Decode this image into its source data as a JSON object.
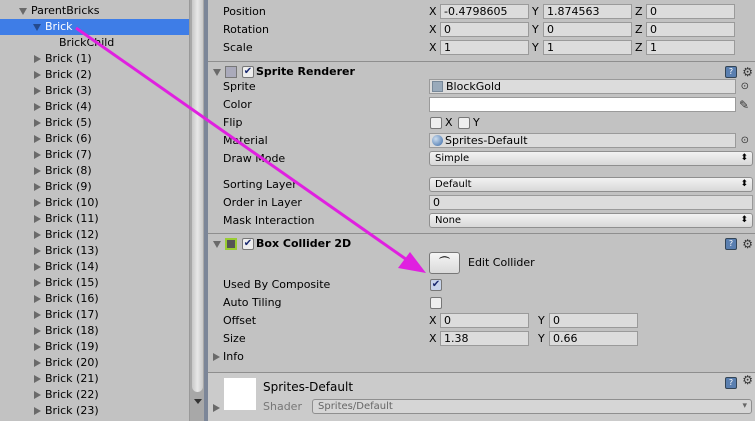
{
  "hierarchy": {
    "root": "ParentBricks",
    "selected": "Brick",
    "child": "BrickChild",
    "items": [
      "Brick (1)",
      "Brick (2)",
      "Brick (3)",
      "Brick (4)",
      "Brick (5)",
      "Brick (6)",
      "Brick (7)",
      "Brick (8)",
      "Brick (9)",
      "Brick (10)",
      "Brick (11)",
      "Brick (12)",
      "Brick (13)",
      "Brick (14)",
      "Brick (15)",
      "Brick (16)",
      "Brick (17)",
      "Brick (18)",
      "Brick (19)",
      "Brick (20)",
      "Brick (21)",
      "Brick (22)",
      "Brick (23)"
    ]
  },
  "transform": {
    "position": {
      "label": "Position",
      "x": "-0.4798605",
      "y": "1.874563",
      "z": "0"
    },
    "rotation": {
      "label": "Rotation",
      "x": "0",
      "y": "0",
      "z": "0"
    },
    "scale": {
      "label": "Scale",
      "x": "1",
      "y": "1",
      "z": "1"
    },
    "axes": {
      "x": "X",
      "y": "Y",
      "z": "Z"
    }
  },
  "sprite_renderer": {
    "title": "Sprite Renderer",
    "sprite_label": "Sprite",
    "sprite": "BlockGold",
    "color_label": "Color",
    "flip_label": "Flip",
    "flip_x": "X",
    "flip_y": "Y",
    "material_label": "Material",
    "material": "Sprites-Default",
    "draw_mode_label": "Draw Mode",
    "draw_mode": "Simple",
    "sorting_layer_label": "Sorting Layer",
    "sorting_layer": "Default",
    "order_label": "Order in Layer",
    "order": "0",
    "mask_label": "Mask Interaction",
    "mask": "None"
  },
  "box_collider": {
    "title": "Box Collider 2D",
    "edit_collider": "Edit Collider",
    "used_by_composite_label": "Used By Composite",
    "auto_tiling_label": "Auto Tiling",
    "offset_label": "Offset",
    "offset_x": "0",
    "offset_y": "0",
    "size_label": "Size",
    "size_x": "1.38",
    "size_y": "0.66",
    "info_label": "Info"
  },
  "material": {
    "name": "Sprites-Default",
    "shader_label": "Shader",
    "shader": "Sprites/Default"
  },
  "colors": {
    "selection": "#3e7de7",
    "annotation_arrow": "#e020e0"
  }
}
